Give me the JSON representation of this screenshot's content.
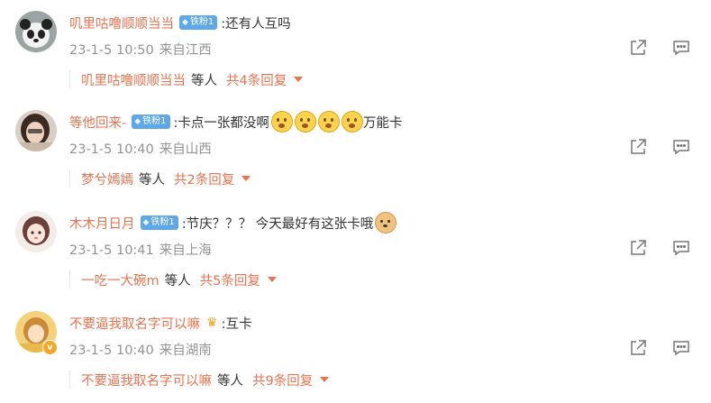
{
  "comments": [
    {
      "username": "叽里咕噜顺顺当当",
      "badge": "铁粉1",
      "text": ":还有人互吗",
      "time": "23-1-5 10:50",
      "source": "来自江西",
      "reply_user": "叽里咕噜顺顺当当",
      "reply_text": "等人",
      "reply_count": "共4条回复",
      "avatar": "panda"
    },
    {
      "username": "等他回来-",
      "badge": "铁粉1",
      "text": ":卡点一张都没啊",
      "text_after": "万能卡",
      "time": "23-1-5 10:40",
      "source": "来自山西",
      "reply_user": "梦兮嫣嫣",
      "reply_text": "等人",
      "reply_count": "共2条回复",
      "avatar": "girl-dark-hair"
    },
    {
      "username": "木木月日月",
      "badge": "铁粉1",
      "text": ":节庆？？？ 今天最好有这张卡哦",
      "time": "23-1-5 10:41",
      "source": "来自上海",
      "reply_user": "一吃一大碗m",
      "reply_text": "等人",
      "reply_count": "共5条回复",
      "avatar": "anime-girl"
    },
    {
      "username": "不要逼我取名字可以嘛",
      "text": ":互卡",
      "time": "23-1-5 10:40",
      "source": "来自湖南",
      "reply_user": "不要逼我取名字可以嘛",
      "reply_text": "等人",
      "reply_count": "共9条回复",
      "avatar": "yellow-girl",
      "verified_badge": "v"
    }
  ],
  "colors": {
    "accent": "#eb7350",
    "meta": "#939393",
    "fan_badge": "#5ea8e8"
  },
  "icons": {
    "share": "share-icon",
    "comment": "comment-icon"
  }
}
